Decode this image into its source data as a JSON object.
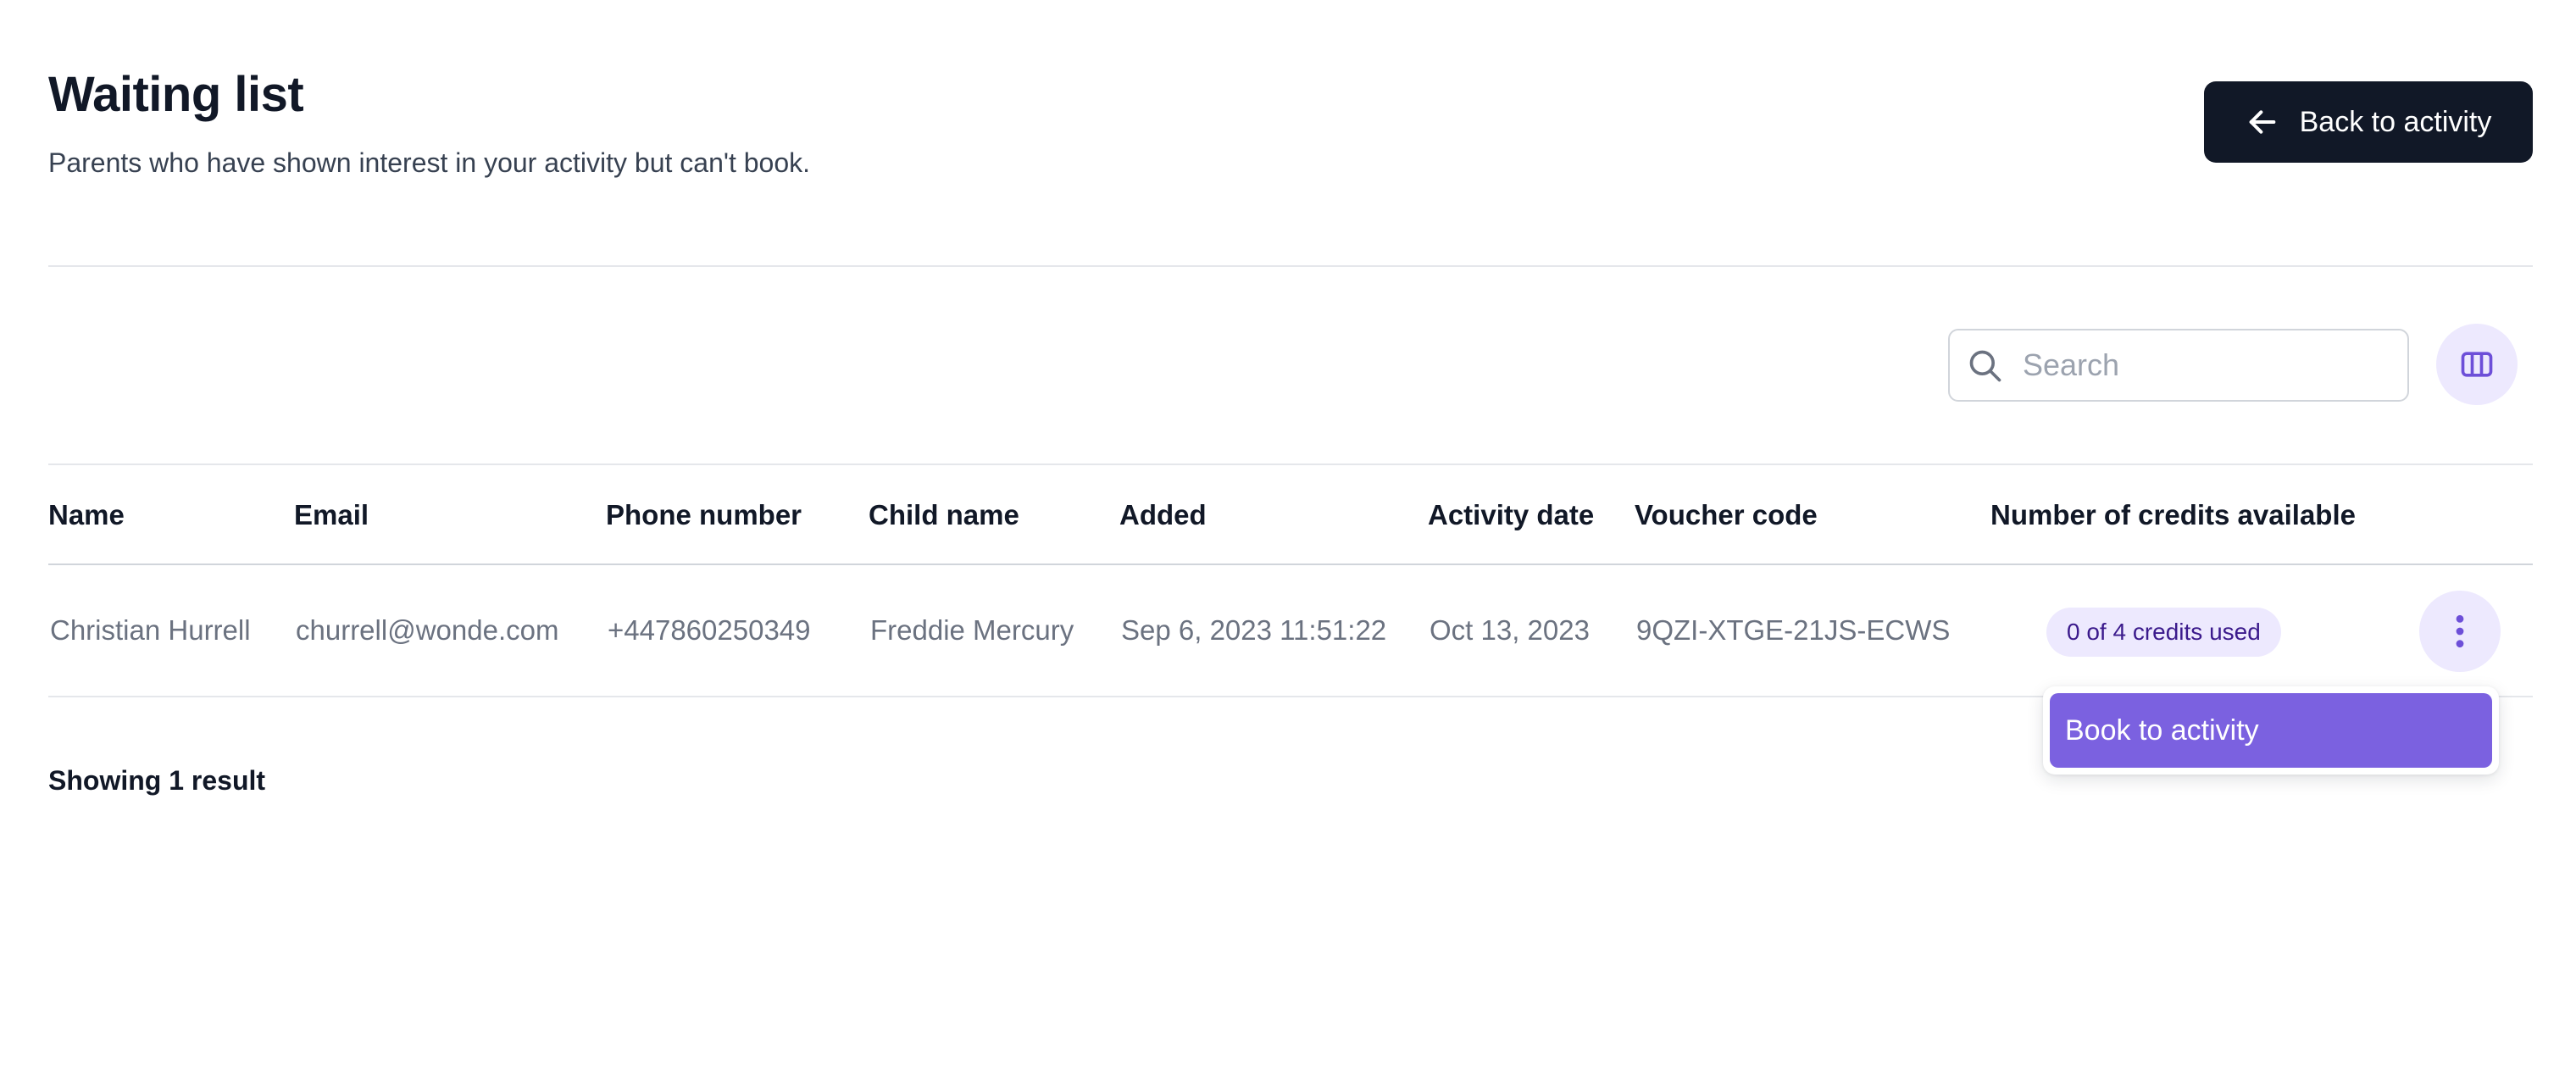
{
  "header": {
    "title": "Waiting list",
    "subtitle": "Parents who have shown interest in your activity but can't book.",
    "back_button_label": "Back to activity"
  },
  "toolbar": {
    "search_placeholder": "Search",
    "search_value": ""
  },
  "table": {
    "columns": [
      "Name",
      "Email",
      "Phone number",
      "Child name",
      "Added",
      "Activity date",
      "Voucher code",
      "Number of credits available"
    ],
    "rows": [
      {
        "name": "Christian Hurrell",
        "email": "churrell@wonde.com",
        "phone": "+447860250349",
        "child_name": "Freddie Mercury",
        "added": "Sep 6, 2023 11:51:22",
        "activity_date": "Oct 13, 2023",
        "voucher_code": "9QZI-XTGE-21JS-ECWS",
        "credits": "0 of 4 credits used"
      }
    ]
  },
  "row_menu": {
    "items": [
      "Book to activity"
    ]
  },
  "footer": {
    "results": "Showing 1 result"
  },
  "icons": {
    "back": "arrow-left-icon",
    "search": "search-icon",
    "columns": "columns-icon",
    "row_actions": "dots-vertical-icon"
  },
  "colors": {
    "primary_dark": "#111827",
    "accent_purple": "#7b61e0",
    "badge_bg": "#ede9fe",
    "badge_text": "#3b1a8c"
  }
}
